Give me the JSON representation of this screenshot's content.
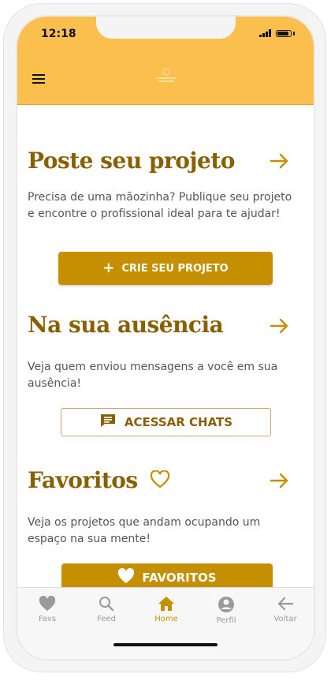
{
  "status": {
    "time": "12:18"
  },
  "header": {
    "menu_icon": "hamburger-icon",
    "brand_color": "#fbbf4d"
  },
  "sections": [
    {
      "title": "Poste seu projeto",
      "description": "Precisa de uma mãozinha? Publique seu projeto e encontre o profissional ideal para te ajudar!",
      "button_label": "CRIE SEU PROJETO",
      "button_icon": "plus-icon"
    },
    {
      "title": "Na sua ausência",
      "description": "Veja quem enviou mensagens a você em sua ausência!",
      "button_label": "ACESSAR CHATS",
      "button_icon": "chat-icon"
    },
    {
      "title": "Favoritos",
      "description": "Veja os projetos que andam ocupando um espaço na sua mente!",
      "button_label": "FAVORITOS",
      "button_icon": "heart-icon"
    }
  ],
  "nav": {
    "items": [
      {
        "label": "Favs",
        "icon": "heart-icon"
      },
      {
        "label": "Feed",
        "icon": "search-icon"
      },
      {
        "label": "Home",
        "icon": "home-icon",
        "active": true
      },
      {
        "label": "Perfil",
        "icon": "user-icon"
      },
      {
        "label": "Voltar",
        "icon": "arrow-left-icon"
      }
    ]
  },
  "colors": {
    "accent": "#c68f00",
    "title": "#8a5f00",
    "nav_inactive": "#9a9a9a"
  }
}
